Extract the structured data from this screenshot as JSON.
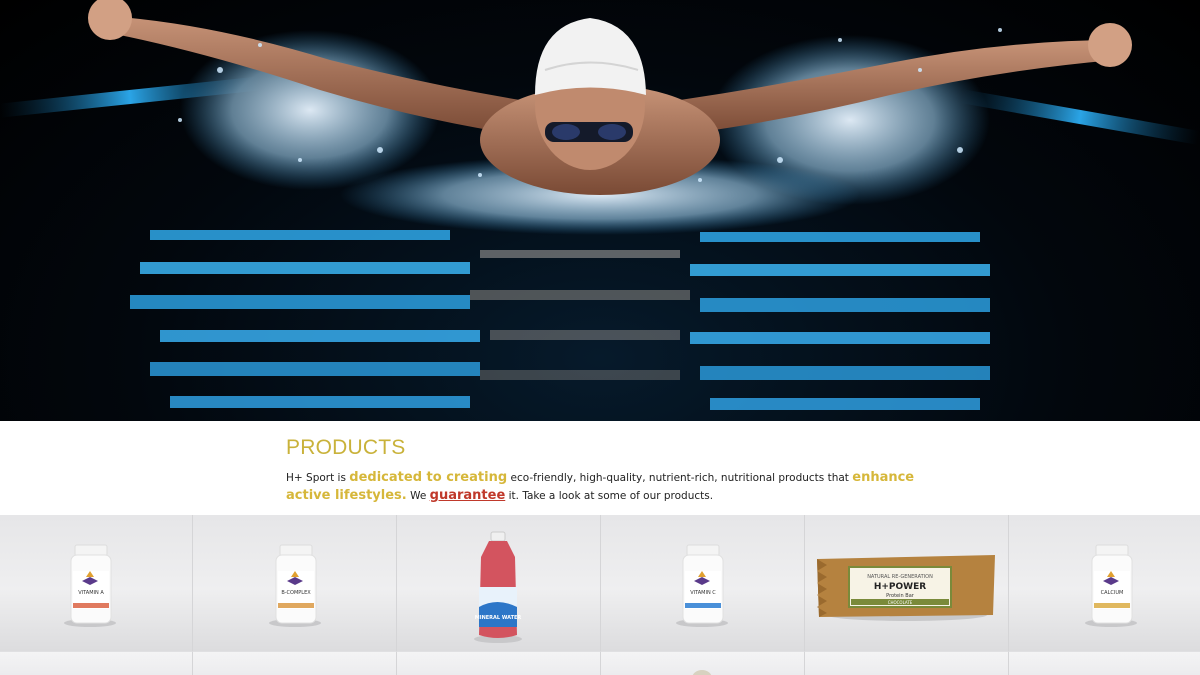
{
  "hero": {
    "image": "swimmer-butterfly-stroke-photo"
  },
  "products": {
    "title": "PRODUCTS",
    "text": {
      "p1": "H+ Sport is ",
      "hl1": "dedicated to creating",
      "p2": " eco-friendly, high-quality, nutrient-rich, nutritional products that ",
      "hl2": "enhance active lifestyles.",
      "p3": " We ",
      "guarantee": "guarantee",
      "p4": " it. Take a look at some of our products."
    }
  },
  "product_tiles": [
    {
      "label": "VITAMIN A",
      "kind": "bottle",
      "stripe": "#e07a5f"
    },
    {
      "label": "B-COMPLEX",
      "kind": "bottle",
      "stripe": "#e0a85f"
    },
    {
      "label": "MINERAL WATER",
      "kind": "water",
      "stripe": "#3a7bd5"
    },
    {
      "label": "VITAMIN C",
      "kind": "bottle",
      "stripe": "#4a90d9"
    },
    {
      "label_top": "H+POWER",
      "label_sub": "Protein Bar",
      "flavor": "CHOCOLATE",
      "kind": "bar",
      "brand": "NATURAL RE-GENERATION"
    },
    {
      "label": "CALCIUM",
      "kind": "bottle",
      "stripe": "#e0b85f"
    }
  ],
  "colors": {
    "accent_gold": "#c9b23a",
    "highlight_gold": "#d6b73a",
    "guarantee_red": "#c0392b"
  }
}
